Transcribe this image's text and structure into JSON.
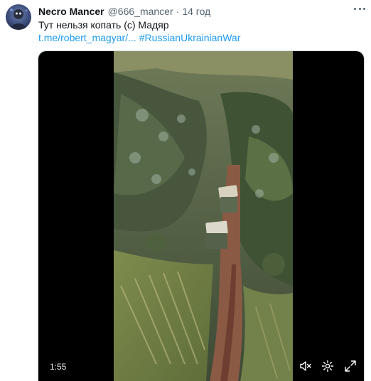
{
  "tweet": {
    "author_name": "Necro Mancer",
    "author_handle": "@666_mancer",
    "separator": "·",
    "timestamp": "14 год",
    "text": "Тут нельзя копать (с) Мадяр",
    "link_text": "t.me/robert_magyar/...",
    "hashtag": "#RussianUkrainianWar"
  },
  "video": {
    "duration": "1:55"
  },
  "icons": {
    "avatar": "avatar-image",
    "more": "more-options-icon",
    "mute": "speaker-muted-icon",
    "settings": "gear-icon",
    "expand": "expand-icon"
  },
  "colors": {
    "link": "#1d9bf0",
    "secondary_text": "#536471",
    "primary_text": "#0f1419",
    "video_background": "#000000"
  }
}
